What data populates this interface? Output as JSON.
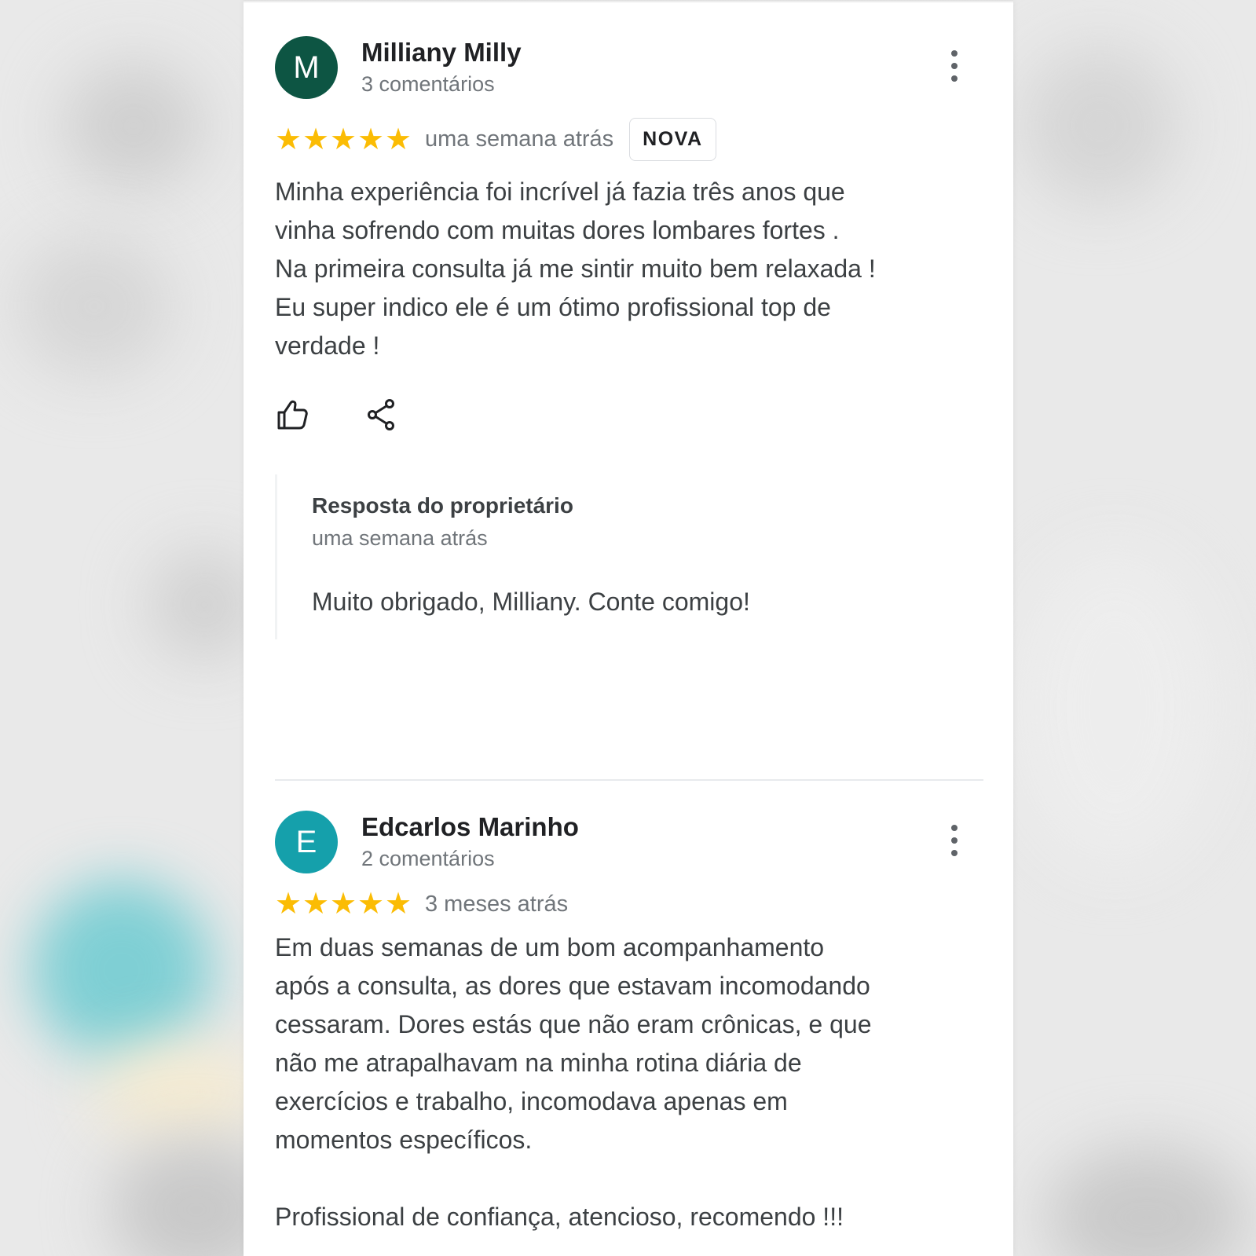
{
  "theme": {
    "star_color": "#fbbc04",
    "avatar_colors": [
      "#0d5543",
      "#15a0ab"
    ]
  },
  "reviews": [
    {
      "avatar_letter": "M",
      "author": "Milliany Milly",
      "comment_count": "3 comentários",
      "rating": 5,
      "time": "uma semana atrás",
      "badge": "NOVA",
      "text": "Minha experiência foi incrível já fazia três anos que\nvinha sofrendo com muitas dores lombares fortes .\nNa primeira consulta já me sintir muito bem relaxada !\nEu super indico ele é um ótimo profissional top de\nverdade !",
      "actions": [
        "thumbs-up-icon",
        "share-icon"
      ],
      "owner_reply": {
        "title": "Resposta do proprietário",
        "time": "uma semana atrás",
        "text": "Muito obrigado, Milliany. Conte comigo!"
      }
    },
    {
      "avatar_letter": "E",
      "author": "Edcarlos Marinho",
      "comment_count": "2 comentários",
      "rating": 5,
      "time": "3 meses atrás",
      "text": "Em duas semanas de um bom acompanhamento\napós a consulta, as dores que estavam incomodando\ncessaram. Dores estás que não eram crônicas, e que\nnão me atrapalhavam na minha rotina diária de\nexercícios e trabalho, incomodava apenas em\nmomentos específicos.\n\nProfissional de confiança, atencioso, recomendo !!!"
    }
  ]
}
